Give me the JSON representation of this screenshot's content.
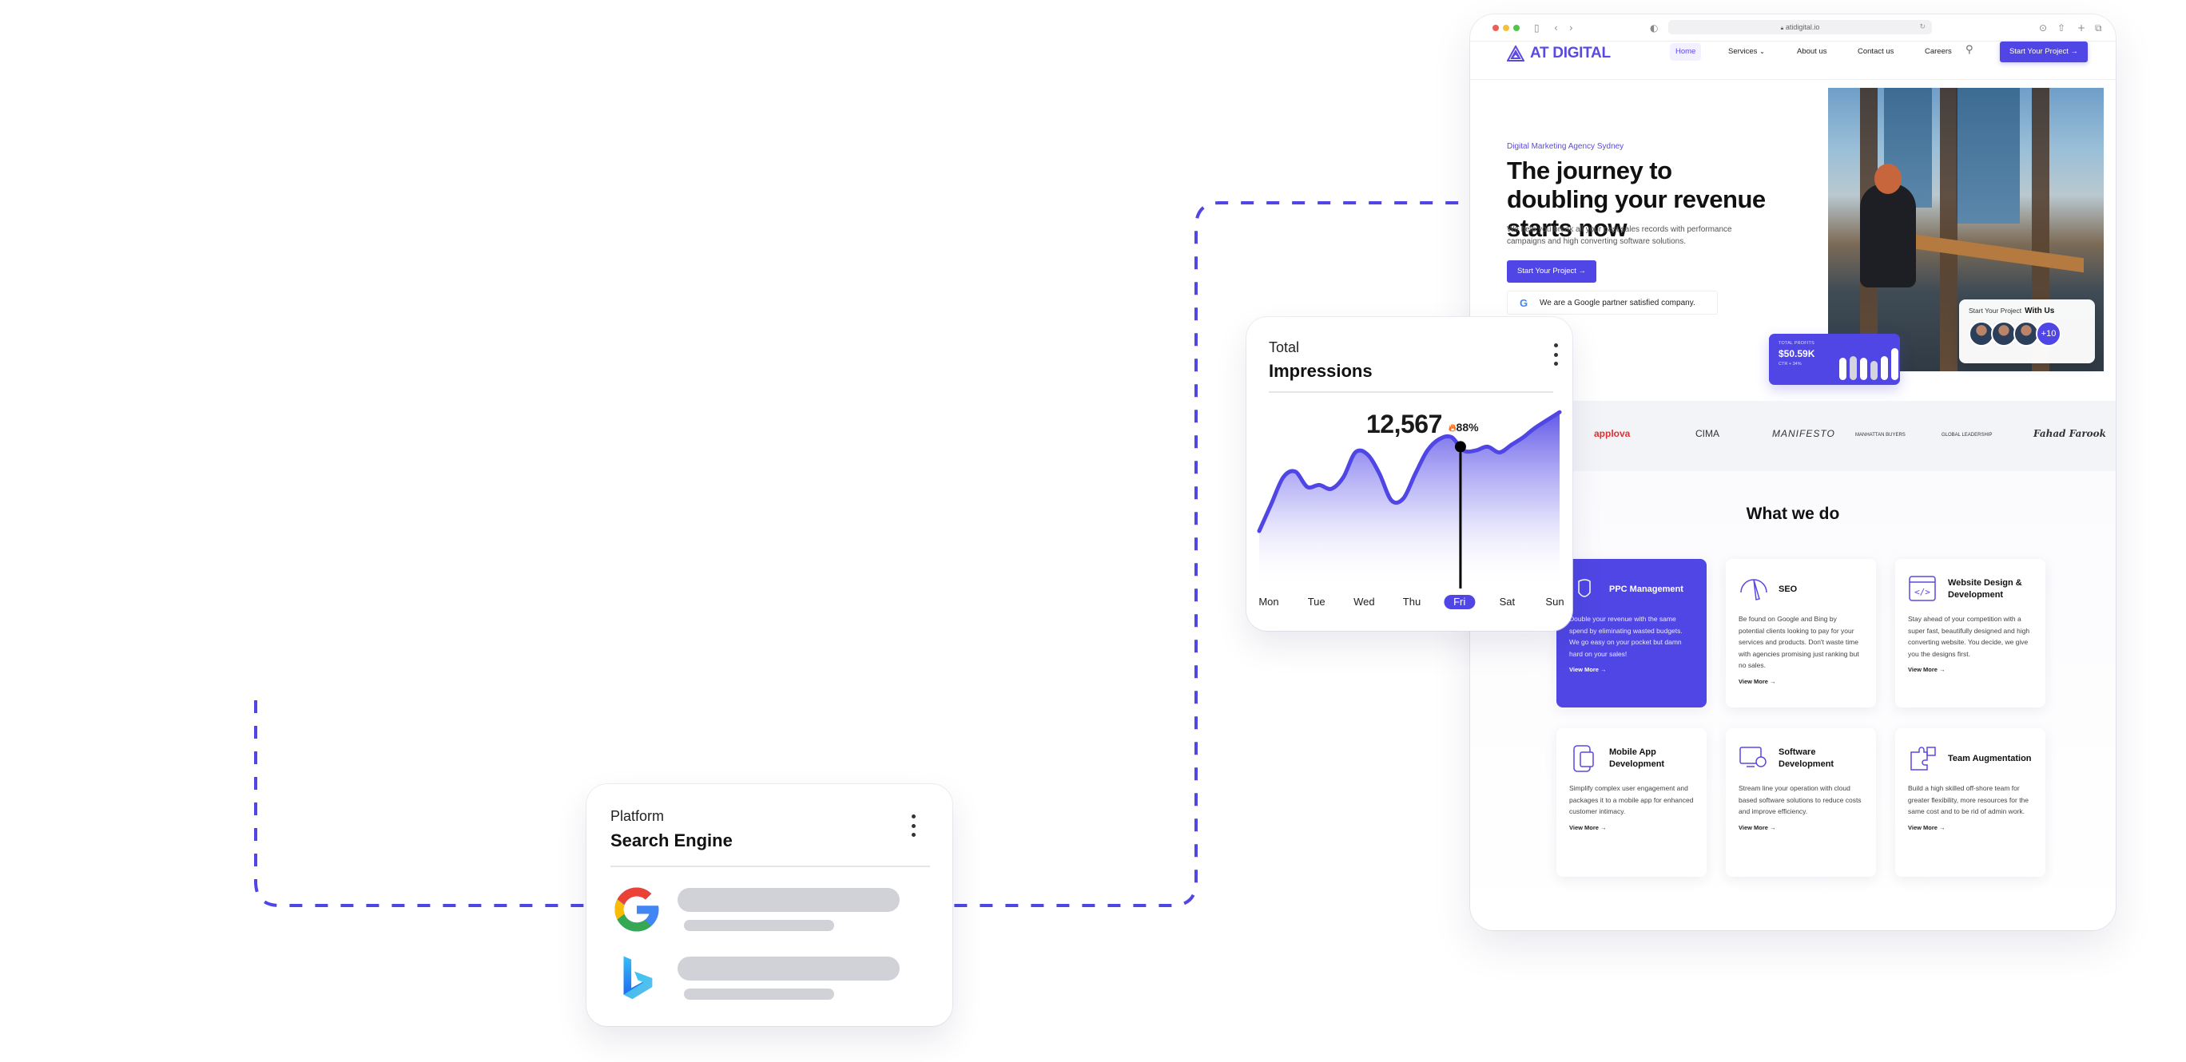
{
  "colors": {
    "accent": "#4f46e5",
    "dash": "#4f46e5",
    "skeleton": "#d0d2d7"
  },
  "browser": {
    "url": "atidigital.io",
    "toolbar_icons": [
      "sidebar-icon",
      "back-icon",
      "forward-icon",
      "privacy-shield-icon",
      "reload-icon",
      "download-icon",
      "share-icon",
      "new-tab-icon",
      "tabs-overview-icon"
    ],
    "site": {
      "logo_text": "AT DIGITAL",
      "nav": {
        "items": [
          {
            "label": "Home",
            "active": true
          },
          {
            "label": "Services",
            "has_dropdown": true
          },
          {
            "label": "About us"
          },
          {
            "label": "Contact us"
          },
          {
            "label": "Careers"
          }
        ],
        "cta": "Start Your Project →"
      },
      "hero": {
        "tagline": "Digital Marketing Agency Sydney",
        "title": "The journey to doubling your revenue starts now",
        "subtitle": "We help you break all your past sales records with performance campaigns and high converting software solutions.",
        "cta": "Start Your Project →",
        "partner_badge_logo": "G",
        "partner_text": "We are a Google partner satisfied company.",
        "profit_card": {
          "label": "TOTAL PROFITS",
          "value": "$50.59K",
          "ctr": "CTR + 34%"
        },
        "team_card": {
          "prefix": "Start Your Project",
          "emphasis": "With Us",
          "more_count": "+10"
        }
      },
      "client_logos": [
        "applova",
        "CIMA",
        "MANIFESTO",
        "MANHATTAN BUYERS",
        "GLOBAL LEADERSHIP",
        "Fahad Farook"
      ],
      "services_section": {
        "title": "What we do",
        "items": [
          {
            "title": "PPC Management",
            "icon": "ppc-icon",
            "active": true,
            "description": "Double your revenue with the same spend by eliminating wasted budgets. We go easy on your pocket but damn hard on your sales!",
            "link": "View More →"
          },
          {
            "title": "SEO",
            "icon": "seo-gauge-icon",
            "description": "Be found on Google and Bing by potential clients looking to pay for your services and products. Don't waste time with agencies promising just ranking but no sales.",
            "link": "View More →"
          },
          {
            "title": "Website Design & Development",
            "icon": "web-code-icon",
            "description": "Stay ahead of your competition with a super fast, beautifully designed and high converting website. You decide, we give you the designs first.",
            "link": "View More →"
          },
          {
            "title": "Mobile App Development",
            "icon": "mobile-app-icon",
            "description": "Simplify complex user engagement and packages it to a mobile app for enhanced customer intimacy.",
            "link": "View More →"
          },
          {
            "title": "Software Development",
            "icon": "software-gear-icon",
            "description": "Stream line your operation with cloud based software solutions to reduce costs and improve efficiency.",
            "link": "View More →"
          },
          {
            "title": "Team Augmentation",
            "icon": "puzzle-icon",
            "description": "Build a high skilled off-shore team for greater flexibility, more resources for the same cost and to be rid of admin work.",
            "link": "View More →"
          }
        ]
      }
    }
  },
  "impressions_card": {
    "label": "Total",
    "title": "Impressions",
    "value": "12,567",
    "delta": "88%",
    "selected_day": "Fri"
  },
  "search_engine_card": {
    "label": "Platform",
    "title": "Search Engine",
    "engines": [
      {
        "name": "Google",
        "icon": "google-icon"
      },
      {
        "name": "Bing",
        "icon": "bing-icon"
      }
    ]
  },
  "chart_data": {
    "type": "area",
    "title": "Total Impressions",
    "categories": [
      "Mon",
      "Tue",
      "Wed",
      "Thu",
      "Fri",
      "Sat",
      "Sun"
    ],
    "highlighted": "Fri",
    "highlight_value_label": "12,567",
    "highlight_delta": "88%",
    "xlabel": "",
    "ylabel": "",
    "ylim": [
      0,
      100
    ],
    "grid": false,
    "series": [
      {
        "name": "Impressions (relative)",
        "x": [
          0,
          0.04,
          0.08,
          0.12,
          0.16,
          0.2,
          0.24,
          0.28,
          0.32,
          0.36,
          0.4,
          0.44,
          0.48,
          0.52,
          0.56,
          0.6,
          0.64,
          0.68,
          0.72,
          0.76,
          0.8,
          0.84,
          0.88,
          0.92,
          1.0
        ],
        "values": [
          30,
          44,
          58,
          61,
          53,
          54,
          52,
          58,
          71,
          70,
          60,
          46,
          47,
          60,
          72,
          78,
          79,
          72,
          72,
          74,
          71,
          75,
          79,
          84,
          92
        ]
      }
    ],
    "marker": {
      "x": 0.67,
      "value": 74
    }
  }
}
